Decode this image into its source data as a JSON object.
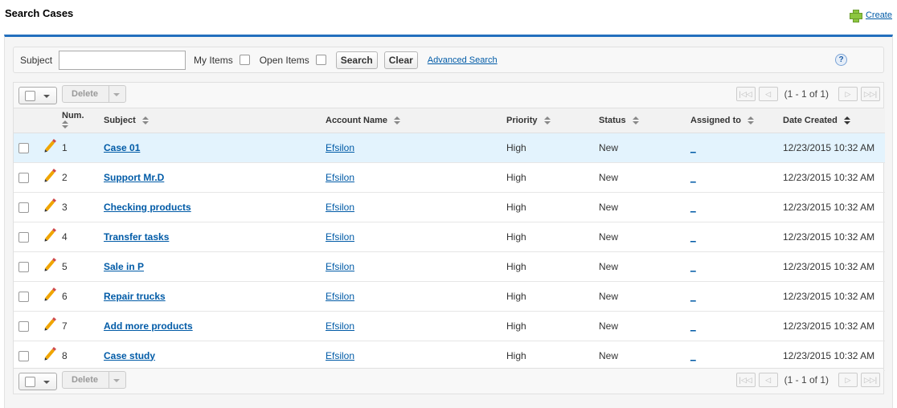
{
  "header": {
    "title": "Search Cases",
    "create_label": "Create"
  },
  "filter": {
    "subject_label": "Subject",
    "subject_value": "",
    "my_items_label": "My Items",
    "open_items_label": "Open Items",
    "search_label": "Search",
    "clear_label": "Clear",
    "advanced_label": "Advanced Search",
    "help_glyph": "?"
  },
  "toolbar": {
    "delete_label": "Delete",
    "page_info": "(1 - 1 of 1)"
  },
  "columns": {
    "num": "Num.",
    "subject": "Subject",
    "account": "Account Name",
    "priority": "Priority",
    "status": "Status",
    "assigned": "Assigned to",
    "created": "Date Created"
  },
  "rows": [
    {
      "num": "1",
      "subject": "Case 01",
      "account": "Efsilon",
      "priority": "High",
      "status": "New",
      "assigned": "_",
      "created": "12/23/2015 10:32 AM"
    },
    {
      "num": "2",
      "subject": "Support Mr.D",
      "account": "Efsilon",
      "priority": "High",
      "status": "New",
      "assigned": "_",
      "created": "12/23/2015 10:32 AM"
    },
    {
      "num": "3",
      "subject": "Checking products",
      "account": "Efsilon",
      "priority": "High",
      "status": "New",
      "assigned": "_",
      "created": "12/23/2015 10:32 AM"
    },
    {
      "num": "4",
      "subject": "Transfer tasks",
      "account": "Efsilon",
      "priority": "High",
      "status": "New",
      "assigned": "_",
      "created": "12/23/2015 10:32 AM"
    },
    {
      "num": "5",
      "subject": "Sale in P",
      "account": "Efsilon",
      "priority": "High",
      "status": "New",
      "assigned": "_",
      "created": "12/23/2015 10:32 AM"
    },
    {
      "num": "6",
      "subject": "Repair trucks",
      "account": "Efsilon",
      "priority": "High",
      "status": "New",
      "assigned": "_",
      "created": "12/23/2015 10:32 AM"
    },
    {
      "num": "7",
      "subject": "Add more products",
      "account": "Efsilon",
      "priority": "High",
      "status": "New",
      "assigned": "_",
      "created": "12/23/2015 10:32 AM"
    },
    {
      "num": "8",
      "subject": "Case study",
      "account": "Efsilon",
      "priority": "High",
      "status": "New",
      "assigned": "_",
      "created": "12/23/2015 10:32 AM"
    }
  ],
  "colors": {
    "accent": "#236fbd",
    "link": "#015ba7",
    "selected_row": "#e3f3fd",
    "create_icon": "#8cc63f"
  },
  "icons": {
    "create": "plus-icon",
    "edit": "pencil-icon",
    "help": "help-icon",
    "sort": "sort-icon"
  }
}
